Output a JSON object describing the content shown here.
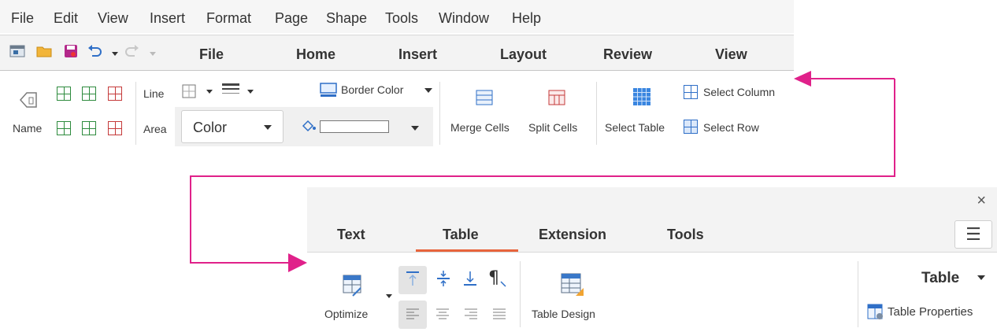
{
  "menubar": {
    "items": [
      "File",
      "Edit",
      "View",
      "Insert",
      "Format",
      "Page",
      "Shape",
      "Tools",
      "Window",
      "Help"
    ]
  },
  "tabbar": {
    "tabs": [
      "File",
      "Home",
      "Insert",
      "Layout",
      "Review",
      "View"
    ]
  },
  "ribbon": {
    "name_label": "Name",
    "line_label": "Line",
    "area_label": "Area",
    "area_value": "Color",
    "border_color_label": "Border Color",
    "merge_cells_label": "Merge Cells",
    "split_cells_label": "Split Cells",
    "select_table_label": "Select Table",
    "select_column_label": "Select Column",
    "select_row_label": "Select Row"
  },
  "panel": {
    "close_glyph": "×",
    "menu_glyph": "☰",
    "tabs": [
      "Text",
      "Table",
      "Extension",
      "Tools"
    ],
    "active_tab": "Table",
    "optimize_label": "Optimize",
    "table_design_label": "Table Design",
    "table_menu_label": "Table",
    "table_properties_label": "Table Properties"
  },
  "colors": {
    "arrow": "#e0218a",
    "tab_underline": "#e8643c",
    "accent_blue": "#2f6fc7"
  }
}
